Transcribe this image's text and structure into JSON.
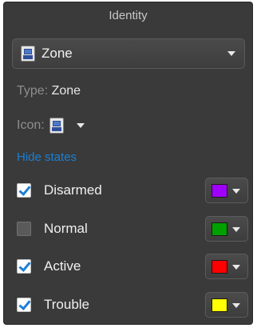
{
  "panel": {
    "title": "Identity"
  },
  "type_select": {
    "value": "Zone",
    "icon": "zone-icon"
  },
  "type_line": {
    "label": "Type:",
    "value": "Zone"
  },
  "icon_line": {
    "label": "Icon:",
    "icon": "zone-icon"
  },
  "states_link": {
    "label": "Hide states"
  },
  "states": [
    {
      "label": "Disarmed",
      "checked": true,
      "color": "#a000ff"
    },
    {
      "label": "Normal",
      "checked": false,
      "color": "#00a000"
    },
    {
      "label": "Active",
      "checked": true,
      "color": "#ff0000"
    },
    {
      "label": "Trouble",
      "checked": true,
      "color": "#ffff00"
    }
  ]
}
